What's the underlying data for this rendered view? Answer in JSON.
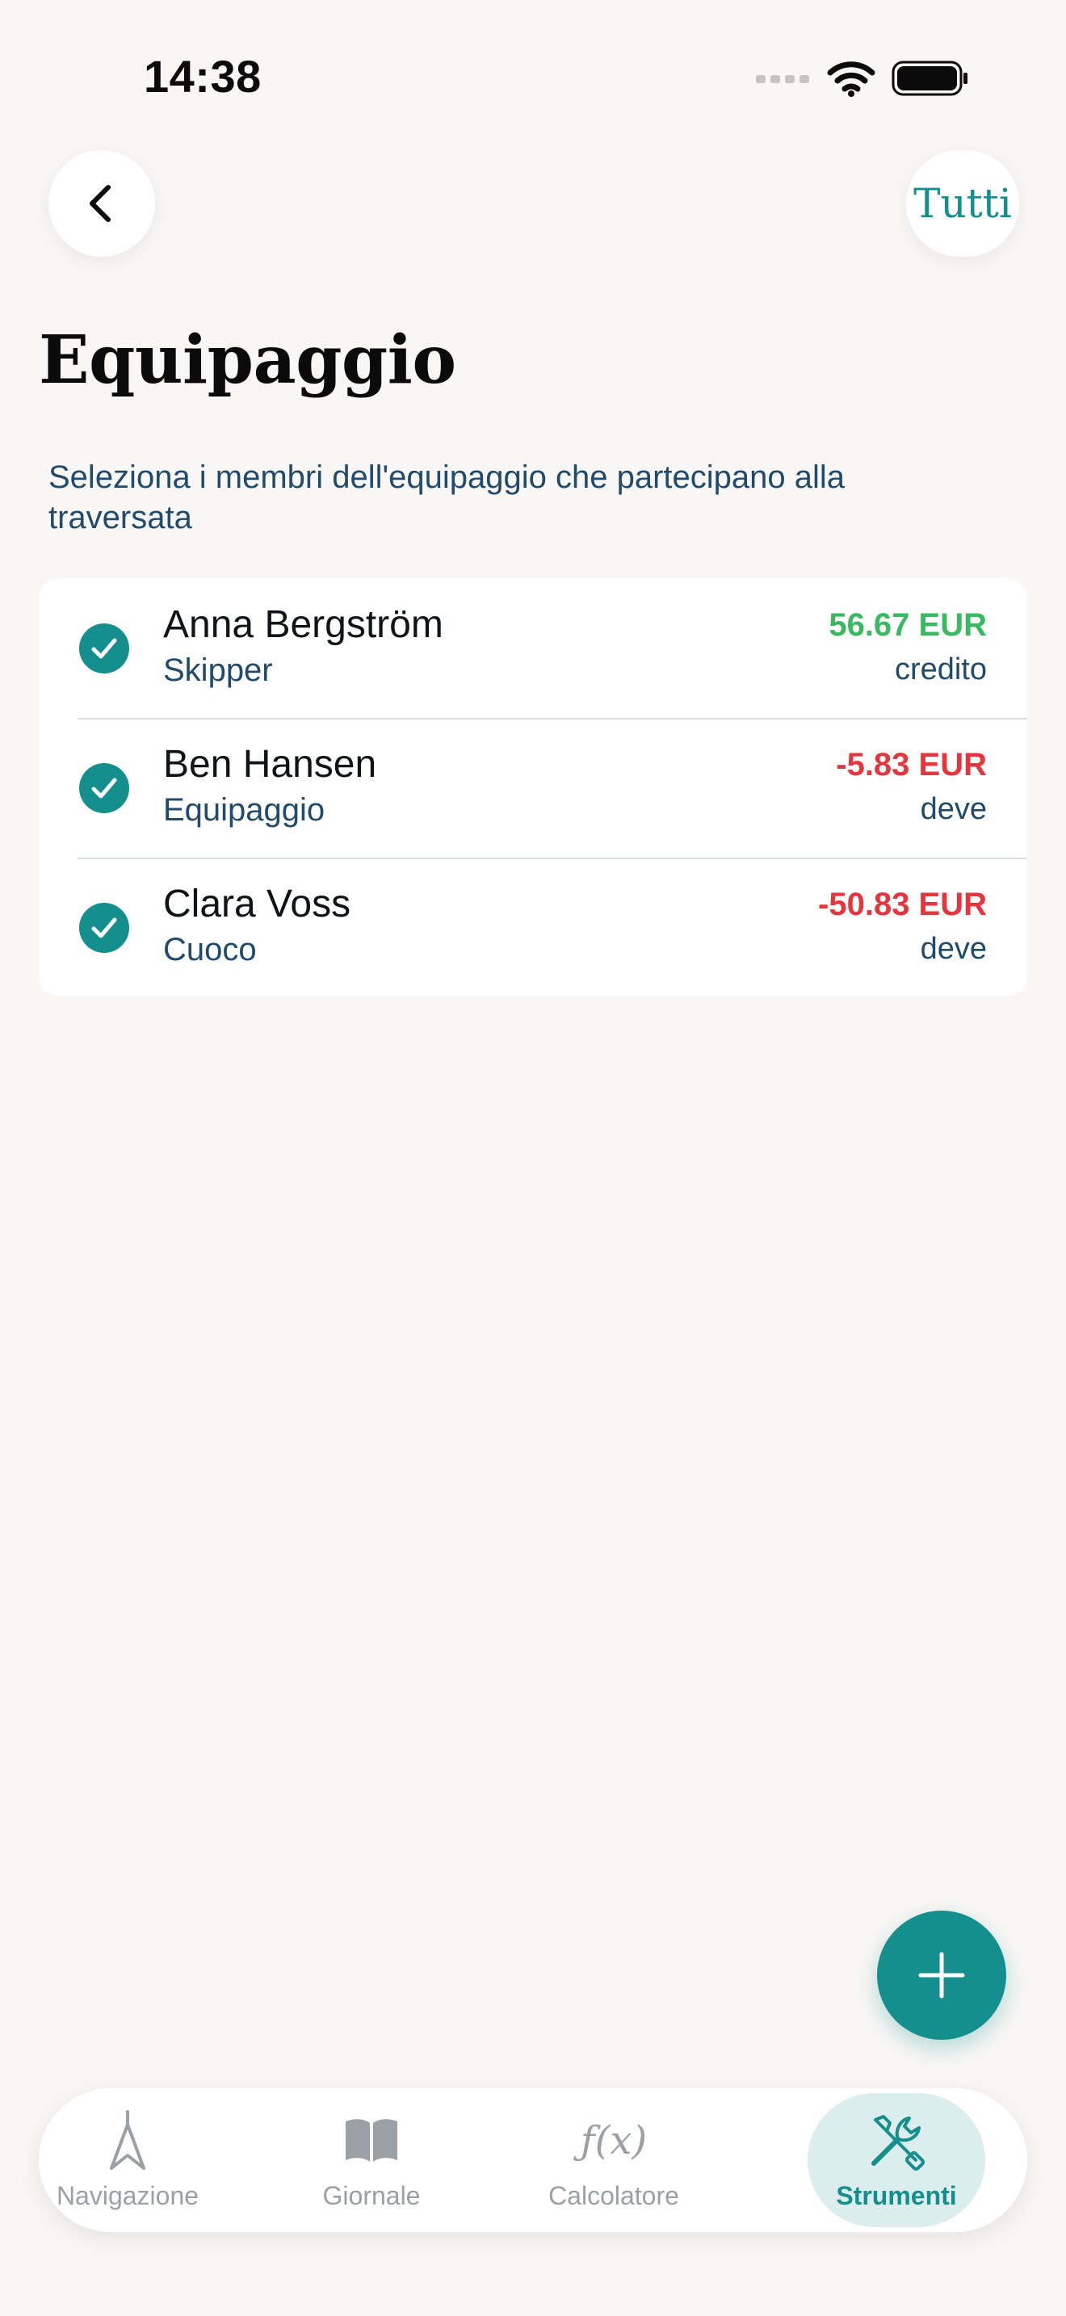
{
  "status_bar": {
    "time": "14:38"
  },
  "header": {
    "back_icon": "chevron-left-icon",
    "select_all_label": "Tutti",
    "title": "Equipaggio",
    "subtitle": "Seleziona i membri dell'equipaggio che partecipano alla traversata"
  },
  "crew": [
    {
      "name": "Anna Bergström",
      "role": "Skipper",
      "amount": "56.67 EUR",
      "status": "credito",
      "selected": true,
      "amount_color": "#3BB862"
    },
    {
      "name": "Ben Hansen",
      "role": "Equipaggio",
      "amount": "-5.83 EUR",
      "status": "deve",
      "selected": true,
      "amount_color": "#E4363F"
    },
    {
      "name": "Clara Voss",
      "role": "Cuoco",
      "amount": "-50.83 EUR",
      "status": "deve",
      "selected": true,
      "amount_color": "#E4363F"
    }
  ],
  "tabs": [
    {
      "label": "Navigazione",
      "icon": "navigation-icon",
      "active": false
    },
    {
      "label": "Giornale",
      "icon": "book-icon",
      "active": false
    },
    {
      "label": "Calcolatore",
      "icon": "function-icon",
      "icon_text": "ƒ(x)",
      "active": false
    },
    {
      "label": "Strumenti",
      "icon": "tools-icon",
      "active": true
    }
  ],
  "colors": {
    "accent": "#148F8E",
    "background": "#F9F7F5",
    "positive": "#3BB862",
    "negative": "#E4363F",
    "secondary_text": "#214A6B"
  }
}
